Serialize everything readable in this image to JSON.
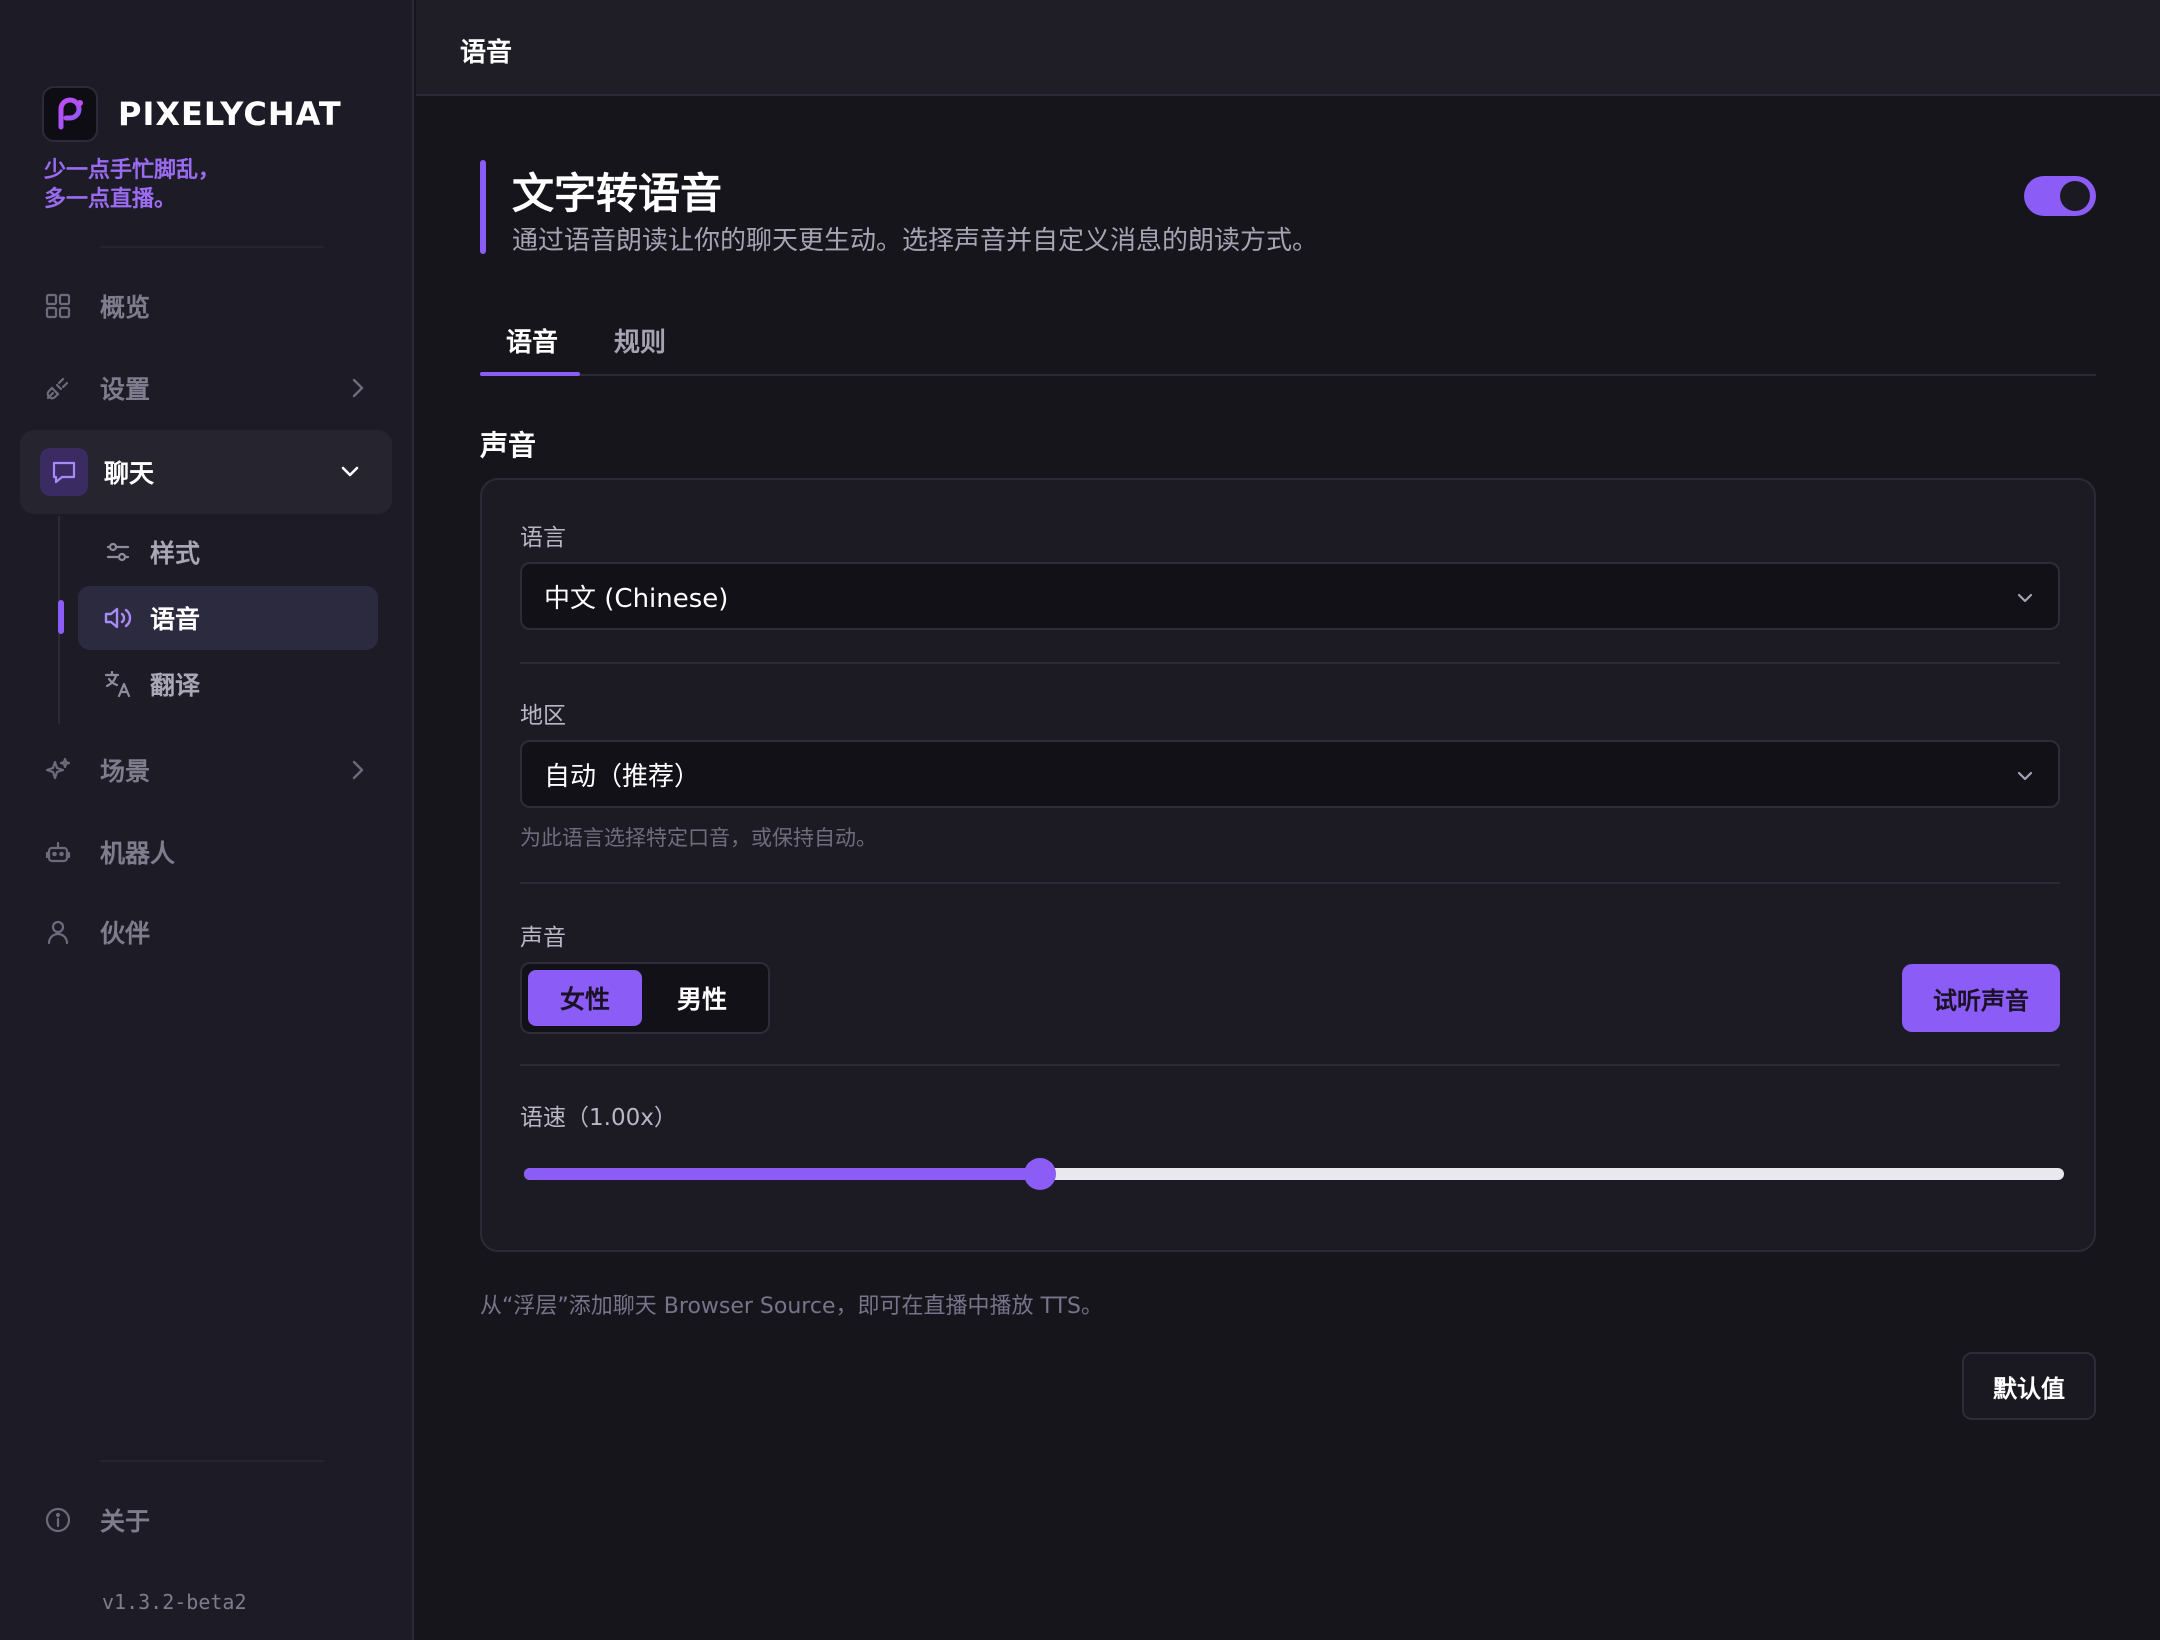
{
  "app": {
    "name": "PIXELYCHAT",
    "tagline_line1": "少一点手忙脚乱，",
    "tagline_line2": "多一点直播。",
    "version": "v1.3.2-beta2",
    "accent_color": "#8b5cf6"
  },
  "sidebar": {
    "items": [
      {
        "label": "概览",
        "icon": "grid-icon"
      },
      {
        "label": "设置",
        "icon": "plug-icon"
      },
      {
        "label": "聊天",
        "icon": "chat-bubble-icon"
      },
      {
        "label": "场景",
        "icon": "sparkle-icon"
      },
      {
        "label": "机器人",
        "icon": "robot-icon"
      },
      {
        "label": "伙伴",
        "icon": "user-icon"
      }
    ],
    "chat_subitems": [
      {
        "label": "样式",
        "icon": "sliders-icon"
      },
      {
        "label": "语音",
        "icon": "speaker-icon"
      },
      {
        "label": "翻译",
        "icon": "translate-icon"
      }
    ],
    "about_label": "关于"
  },
  "header": {
    "title": "语音"
  },
  "tts": {
    "title": "文字转语音",
    "description": "通过语音朗读让你的聊天更生动。选择声音并自定义消息的朗读方式。",
    "enabled": true,
    "tabs": [
      "语音",
      "规则"
    ],
    "active_tab": "语音",
    "section_heading": "声音",
    "language_label": "语言",
    "language_value": "中文 (Chinese)",
    "region_label": "地区",
    "region_value": "自动（推荐）",
    "region_hint": "为此语言选择特定口音，或保持自动。",
    "voice_label": "声音",
    "voice_options": [
      "女性",
      "男性"
    ],
    "voice_selected": "女性",
    "preview_label": "试听声音",
    "speed_label": "语速（1.00x）",
    "speed_fraction": 0.335,
    "footnote": "从“浮层”添加聊天 Browser Source，即可在直播中播放 TTS。",
    "default_label": "默认值"
  }
}
